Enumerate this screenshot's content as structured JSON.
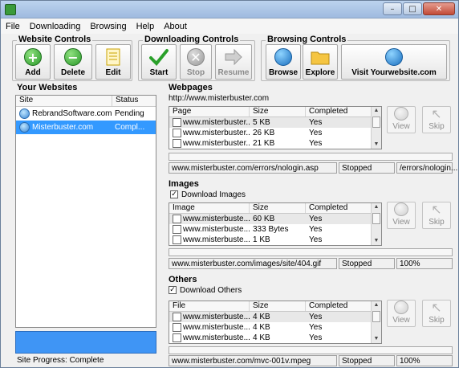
{
  "menu": [
    "File",
    "Downloading",
    "Browsing",
    "Help",
    "About"
  ],
  "window_buttons": {
    "minimize": "–",
    "maximize": "□",
    "close": "✕"
  },
  "website_controls": {
    "title": "Website Controls",
    "add": "Add",
    "delete": "Delete",
    "edit": "Edit"
  },
  "downloading_controls": {
    "title": "Downloading Controls",
    "start": "Start",
    "stop": "Stop",
    "resume": "Resume"
  },
  "browsing_controls": {
    "title": "Browsing Controls",
    "browse": "Browse",
    "explore": "Explore",
    "visit": "Visit Yourwebsite.com"
  },
  "your_websites": {
    "title": "Your Websites",
    "columns": [
      "Site",
      "Status"
    ],
    "rows": [
      {
        "site": "RebrandSoftware.com",
        "status": "Pending"
      },
      {
        "site": "Misterbuster.com",
        "status": "Compl..."
      }
    ],
    "site_progress": "Site Progress: Complete"
  },
  "webpages": {
    "title": "Webpages",
    "url": "http://www.misterbuster.com",
    "columns": [
      "Page",
      "Size",
      "Completed"
    ],
    "rows": [
      {
        "name": "www.misterbuster...",
        "size": "5 KB",
        "completed": "Yes"
      },
      {
        "name": "www.misterbuster...",
        "size": "26 KB",
        "completed": "Yes"
      },
      {
        "name": "www.misterbuster...",
        "size": "21 KB",
        "completed": "Yes"
      }
    ],
    "status_url": "www.misterbuster.com/errors/nologin.asp",
    "status_state": "Stopped",
    "status_path": "/errors/nologin...",
    "view": "View",
    "skip": "Skip"
  },
  "images": {
    "title": "Images",
    "checkbox_label": "Download Images",
    "columns": [
      "Image",
      "Size",
      "Completed"
    ],
    "rows": [
      {
        "name": "www.misterbuste...",
        "size": "60 KB",
        "completed": "Yes"
      },
      {
        "name": "www.misterbuste...",
        "size": "333 Bytes",
        "completed": "Yes"
      },
      {
        "name": "www.misterbuste...",
        "size": "1 KB",
        "completed": "Yes"
      }
    ],
    "status_url": "www.misterbuster.com/images/site/404.gif",
    "status_state": "Stopped",
    "status_percent": "100%",
    "view": "View",
    "skip": "Skip"
  },
  "others": {
    "title": "Others",
    "checkbox_label": "Download Others",
    "columns": [
      "File",
      "Size",
      "Completed"
    ],
    "rows": [
      {
        "name": "www.misterbuste...",
        "size": "4 KB",
        "completed": "Yes"
      },
      {
        "name": "www.misterbuste...",
        "size": "4 KB",
        "completed": "Yes"
      },
      {
        "name": "www.misterbuste...",
        "size": "4 KB",
        "completed": "Yes"
      }
    ],
    "status_url": "www.misterbuster.com/mvc-001v.mpeg",
    "status_state": "Stopped",
    "status_percent": "100%",
    "view": "View",
    "skip": "Skip"
  },
  "colors": {
    "selection": "#3399ff",
    "progress_fill": "#3f95f5"
  }
}
